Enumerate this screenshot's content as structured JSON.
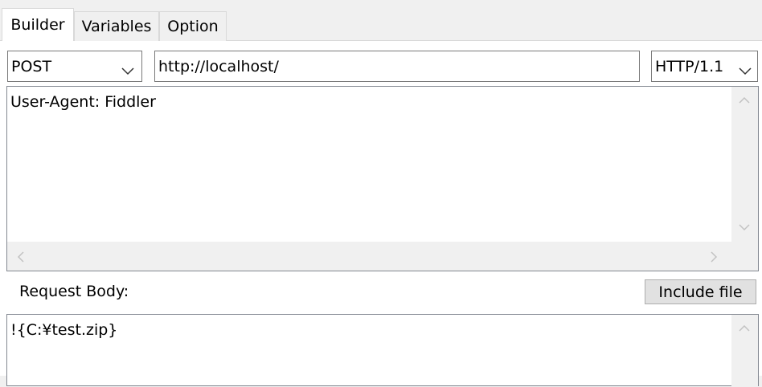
{
  "tabs": [
    {
      "label": "Builder",
      "active": true
    },
    {
      "label": "Variables",
      "active": false
    },
    {
      "label": "Option",
      "active": false
    }
  ],
  "request": {
    "method": "POST",
    "url": "http://localhost/",
    "version": "HTTP/1.1",
    "headers_text": "User-Agent: Fiddler"
  },
  "body": {
    "label": "Request Body:",
    "include_file_label": "Include file",
    "text": "!{C:¥test.zip}"
  },
  "icons": {
    "dropdown": "chevron-down-icon",
    "scroll_up": "scroll-up-arrow-icon",
    "scroll_down": "scroll-down-arrow-icon",
    "scroll_left": "scroll-left-arrow-icon",
    "scroll_right": "scroll-right-arrow-icon"
  },
  "colors": {
    "window_bg": "#f0f0f0",
    "panel_bg": "#ffffff",
    "border": "#7a7a7a",
    "button_bg": "#e1e1e1",
    "scrollbar_bg": "#f0f0f0"
  }
}
